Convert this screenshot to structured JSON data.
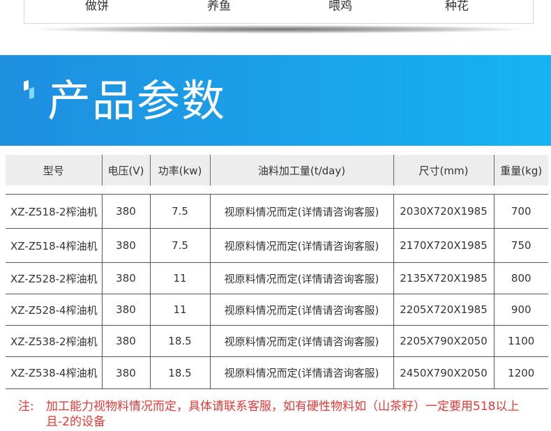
{
  "top_nav": {
    "items": [
      "做饼",
      "养鱼",
      "喂鸡",
      "种花"
    ]
  },
  "banner": {
    "title": "产品参数"
  },
  "table": {
    "headers": [
      "型号",
      "电压(V)",
      "功率(kw)",
      "油料加工量(t/day)",
      "尺寸(mm)",
      "重量(kg)"
    ],
    "rows": [
      [
        "XZ-Z518-2榨油机",
        "380",
        "7.5",
        "视原料情况而定(详情请咨询客服)",
        "2030X720X1985",
        "700"
      ],
      [
        "XZ-Z518-4榨油机",
        "380",
        "7.5",
        "视原料情况而定(详情请咨询客服)",
        "2170X720X1985",
        "750"
      ],
      [
        "XZ-Z528-2榨油机",
        "380",
        "11",
        "视原料情况而定(详情请咨询客服)",
        "2135X720X1985",
        "800"
      ],
      [
        "XZ-Z528-4榨油机",
        "380",
        "11",
        "视原料情况而定(详情请咨询客服)",
        "2205X720X1985",
        "900"
      ],
      [
        "XZ-Z538-2榨油机",
        "380",
        "18.5",
        "视原料情况而定(详情请咨询客服)",
        "2205X790X2050",
        "1100"
      ],
      [
        "XZ-Z538-4榨油机",
        "380",
        "18.5",
        "视原料情况而定(详情请咨询客服)",
        "2450X790X2050",
        "1200"
      ]
    ]
  },
  "note": {
    "label": "注:",
    "text": "加工能力视物料情况而定，具体请联系客服，如有硬性物料如（山茶籽）一定要用518以上且-2的设备"
  },
  "colors": {
    "banner_blue": "#1a9be6",
    "note_red": "#e53935",
    "header_gray": "#ededed"
  }
}
